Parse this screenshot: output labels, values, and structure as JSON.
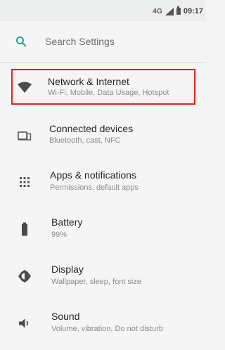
{
  "status_bar": {
    "network": "4G",
    "time": "09:17"
  },
  "search": {
    "placeholder": "Search Settings"
  },
  "settings_items": [
    {
      "icon": "wifi-icon",
      "title": "Network & Internet",
      "subtitle": "Wi-Fi, Mobile, Data Usage, Hotspot",
      "highlighted": true
    },
    {
      "icon": "devices-icon",
      "title": "Connected devices",
      "subtitle": "Bluetooth, cast, NFC"
    },
    {
      "icon": "apps-icon",
      "title": "Apps & notifications",
      "subtitle": "Permissions, default apps"
    },
    {
      "icon": "battery-icon",
      "title": "Battery",
      "subtitle": "99%"
    },
    {
      "icon": "brightness-icon",
      "title": "Display",
      "subtitle": "Wallpaper, sleep, font size"
    },
    {
      "icon": "volume-icon",
      "title": "Sound",
      "subtitle": "Volume, vibration, Do not disturb"
    }
  ],
  "colors": {
    "accent": "#1a9e8a",
    "highlight": "#e0241c"
  }
}
